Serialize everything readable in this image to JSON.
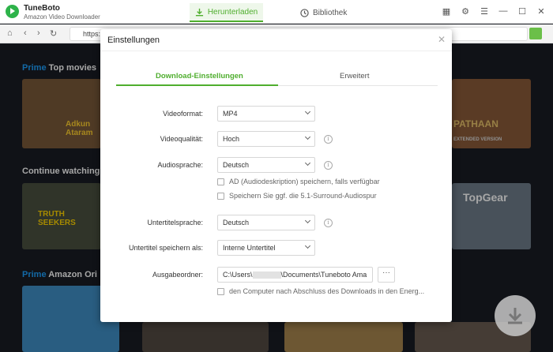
{
  "app": {
    "name": "TuneBoto",
    "subtitle": "Amazon Video Downloader"
  },
  "nav_tabs": {
    "download": "Herunterladen",
    "library": "Bibliothek"
  },
  "browser": {
    "url": "https:"
  },
  "background": {
    "rows": [
      {
        "prime": "Prime",
        "title": "Top movies"
      },
      {
        "prime": "",
        "title": "Continue watching"
      },
      {
        "prime": "Prime",
        "title": "Amazon Ori"
      }
    ],
    "tiles": {
      "left_top": "Adkun Ataram",
      "right_top": "PATHAAN",
      "right_top_sub": "EXTENDED VERSION",
      "left_mid": "TRUTH SEEKERS",
      "right_mid": "TopGear"
    }
  },
  "dialog": {
    "title": "Einstellungen",
    "tabs": {
      "general": "Download-Einstellungen",
      "advanced": "Erweitert"
    },
    "fields": {
      "video_format": {
        "label": "Videoformat:",
        "value": "MP4"
      },
      "video_quality": {
        "label": "Videoqualität:",
        "value": "Hoch"
      },
      "audio_language": {
        "label": "Audiosprache:",
        "value": "Deutsch"
      },
      "subtitle_language": {
        "label": "Untertitelsprache:",
        "value": "Deutsch"
      },
      "subtitle_save_as": {
        "label": "Untertitel speichern als:",
        "value": "Interne Untertitel"
      },
      "output_folder": {
        "label": "Ausgabeordner:",
        "value_prefix": "C:\\Users\\",
        "value_suffix": "\\Documents\\Tuneboto Ama"
      }
    },
    "checkboxes": {
      "ad": "AD (Audiodeskription) speichern, falls verfügbar",
      "surround": "Speichern Sie ggf. die 5.1-Surround-Audiospur",
      "shutdown": "den Computer nach Abschluss des Downloads in den Energ..."
    },
    "more_button": "···"
  },
  "colors": {
    "accent": "#4fae2e",
    "prime_blue": "#1ea1ff"
  }
}
